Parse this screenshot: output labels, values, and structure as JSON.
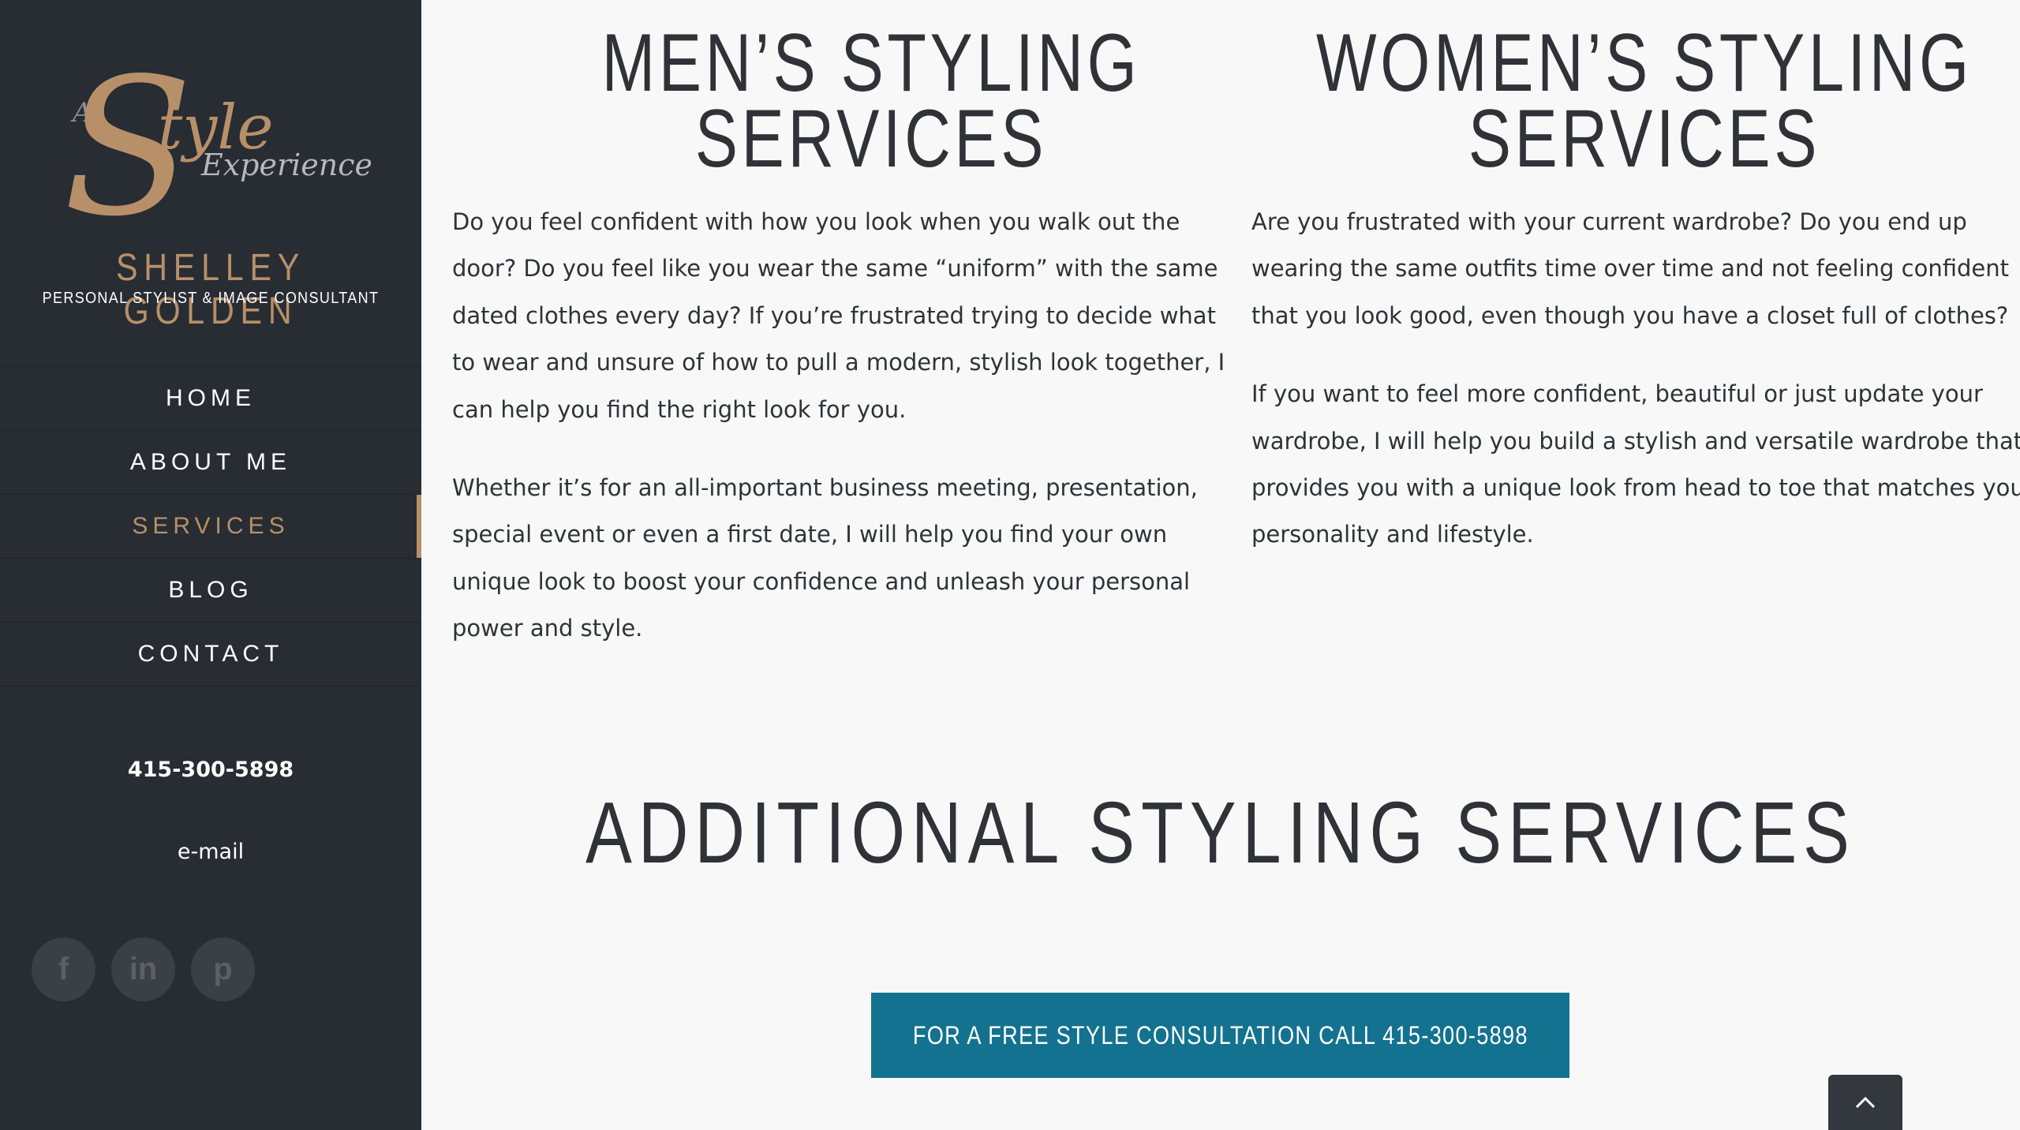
{
  "brand": {
    "logo_prefix": "A",
    "logo_word": "tyle",
    "logo_initial": "S",
    "logo_tail": "Experience",
    "name": "SHELLEY GOLDEN",
    "subtitle": "PERSONAL STYLIST & IMAGE CONSULTANT",
    "accent_color": "#b79069"
  },
  "nav": {
    "items": [
      {
        "label": "HOME",
        "active": false
      },
      {
        "label": "ABOUT ME",
        "active": false
      },
      {
        "label": "SERVICES",
        "active": true
      },
      {
        "label": "BLOG",
        "active": false
      },
      {
        "label": "CONTACT",
        "active": false
      }
    ]
  },
  "sidebar": {
    "phone": "415-300-5898",
    "email": "e-mail",
    "socials": [
      {
        "icon": "facebook-icon",
        "glyph": "f"
      },
      {
        "icon": "linkedin-icon",
        "glyph": "in"
      },
      {
        "icon": "pinterest-icon",
        "glyph": "p"
      }
    ]
  },
  "mens": {
    "title_line1": "MEN’S STYLING",
    "title_line2": "SERVICES",
    "para1": "Do you feel confident with how you look when you walk out the door? Do you feel like you wear the same “uniform” with the same dated clothes every day? If you’re frustrated trying to decide what to wear and unsure of how to pull a modern, stylish look together, I can help you find the right look for you.",
    "para2": "Whether it’s for an all-important business meeting, presentation, special event or even a first date, I will help you find your own unique look to boost your confidence and unleash your personal power and style."
  },
  "womens": {
    "title_line1": "WOMEN’S STYLING",
    "title_line2": "SERVICES",
    "para1": "Are you frustrated with your current wardrobe? Do you end up wearing the same outfits time over time and not feeling confident that you look good, even though you have a closet full of clothes?",
    "para2": "If you want to feel more confident, beautiful or just update your wardrobe, I will help you build a stylish and versatile wardrobe that provides you with a unique look from head to toe that matches your personality and lifestyle."
  },
  "additional": {
    "title": "ADDITIONAL STYLING SERVICES",
    "cta_label": "FOR A FREE STYLE CONSULTATION CALL 415-300-5898",
    "cta_color": "#13728f"
  }
}
